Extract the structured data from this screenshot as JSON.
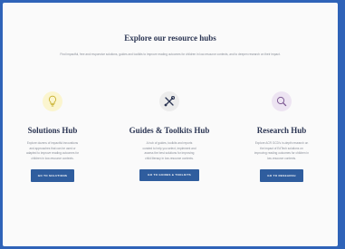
{
  "page": {
    "heading": "Explore our resource hubs",
    "intro": "Find impactful, free and responsive solutions, guides and toolkits to improve reading outcomes for children in low-resource contexts, and to deepen research on their impact."
  },
  "hubs": [
    {
      "icon": "lightbulb-icon",
      "icon_bg": "#fbf5cf",
      "icon_color": "#c9b233",
      "title": "Solutions Hub",
      "description": "Explore dozens of impactful innovations and approaches that can be used or adapted to improve reading outcomes for children in low-resource contexts.",
      "button": "GO TO SOLUTIONS"
    },
    {
      "icon": "tools-icon",
      "icon_bg": "#ececec",
      "icon_color": "#2b3553",
      "title": "Guides & Toolkits Hub",
      "description": "A hub of guides, toolkits and reports curated to help you select, implement and assess the best solutions for improving child literacy in low-resource contexts.",
      "button": "GO TO GUIDES & TOOLKITS"
    },
    {
      "icon": "magnifier-icon",
      "icon_bg": "#ede4f2",
      "icon_color": "#7d5a93",
      "title": "Research Hub",
      "description": "Explore ACR GCD's in-depth research on the impact of EdTech solutions on improving reading outcomes for children in low-resource contexts.",
      "button": "GO TO RESEARCH"
    }
  ]
}
